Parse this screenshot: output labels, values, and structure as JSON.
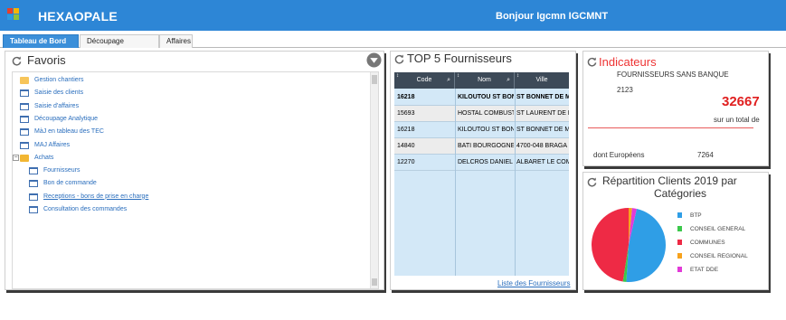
{
  "header": {
    "app_title": "HEXAOPALE",
    "greeting": "Bonjour Igcmn IGCMNT",
    "logo_colors": [
      "#e8402a",
      "#f7b500",
      "#2d9be0",
      "#8fc13a"
    ]
  },
  "tabs": [
    {
      "label": "Tableau de Bord",
      "active": true
    },
    {
      "label": "Découpage Analytique",
      "active": false
    },
    {
      "label": "Affaires",
      "active": false
    }
  ],
  "favoris": {
    "title": "Favoris",
    "items": [
      {
        "label": "Gestion chantiers",
        "icon": "folder-open-icon",
        "level": 0
      },
      {
        "label": "Saisie des clients",
        "icon": "window-icon",
        "level": 0
      },
      {
        "label": "Saisie d'affaires",
        "icon": "window-icon",
        "level": 0
      },
      {
        "label": "Découpage Analytique",
        "icon": "window-icon",
        "level": 0
      },
      {
        "label": "MàJ en tableau des TEC",
        "icon": "window-icon",
        "level": 0
      },
      {
        "label": "MAJ Affaires",
        "icon": "window-icon",
        "level": 0
      },
      {
        "label": "Achats",
        "icon": "folder-icon",
        "level": 0,
        "expander": "−"
      },
      {
        "label": "Fournisseurs",
        "icon": "window-icon",
        "level": 1
      },
      {
        "label": "Bon de commande",
        "icon": "window-icon",
        "level": 1
      },
      {
        "label": "Receptions - bons de prise en charge",
        "icon": "window-icon",
        "level": 1,
        "underline": true
      },
      {
        "label": "Consultation des commandes",
        "icon": "window-icon",
        "level": 1
      }
    ]
  },
  "top5": {
    "title": "TOP 5 Fournisseurs",
    "columns": [
      "Code",
      "Nom",
      "Ville"
    ],
    "rows": [
      {
        "code": "16218",
        "nom": "KILOUTOU ST BONN",
        "ville": "ST BONNET DE MU",
        "bold": true
      },
      {
        "code": "15693",
        "nom": "HOSTAL COMBUSTIE",
        "ville": "ST LAURENT DE MI",
        "bold": false
      },
      {
        "code": "16218",
        "nom": "KILOUTOU ST BONN",
        "ville": "ST BONNET DE MU",
        "bold": false
      },
      {
        "code": "14840",
        "nom": "BATI BOURGOGNE C",
        "ville": "4700-048 BRAGA",
        "bold": false
      },
      {
        "code": "12270",
        "nom": "DELCROS DANIEL",
        "ville": "ALBARET LE COMT",
        "bold": false
      }
    ],
    "link": "Liste des Fournisseurs"
  },
  "indicateurs": {
    "title": "Indicateurs",
    "label": "FOURNISSEURS SANS BANQUE",
    "count": "2123",
    "big_value": "32667",
    "total_label": "sur un total de",
    "europeens_label": "dont Européens",
    "europeens_value": "7264"
  },
  "repartition": {
    "title_line1": "Répartition Clients 2019  par",
    "title_line2": "Catégories"
  },
  "chart_data": {
    "type": "pie",
    "title": "Répartition Clients 2019  par Catégories",
    "categories": [
      "BTP",
      "CONSEIL GENERAL",
      "COMMUNES",
      "CONSEIL REGIONAL",
      "ETAT DDE"
    ],
    "values": [
      47.5,
      1.5,
      47.5,
      1.5,
      2.0
    ],
    "colors": [
      "#2f9ee6",
      "#3cc84b",
      "#ee2a45",
      "#f7a21c",
      "#e23ad8"
    ],
    "legend": "right"
  }
}
